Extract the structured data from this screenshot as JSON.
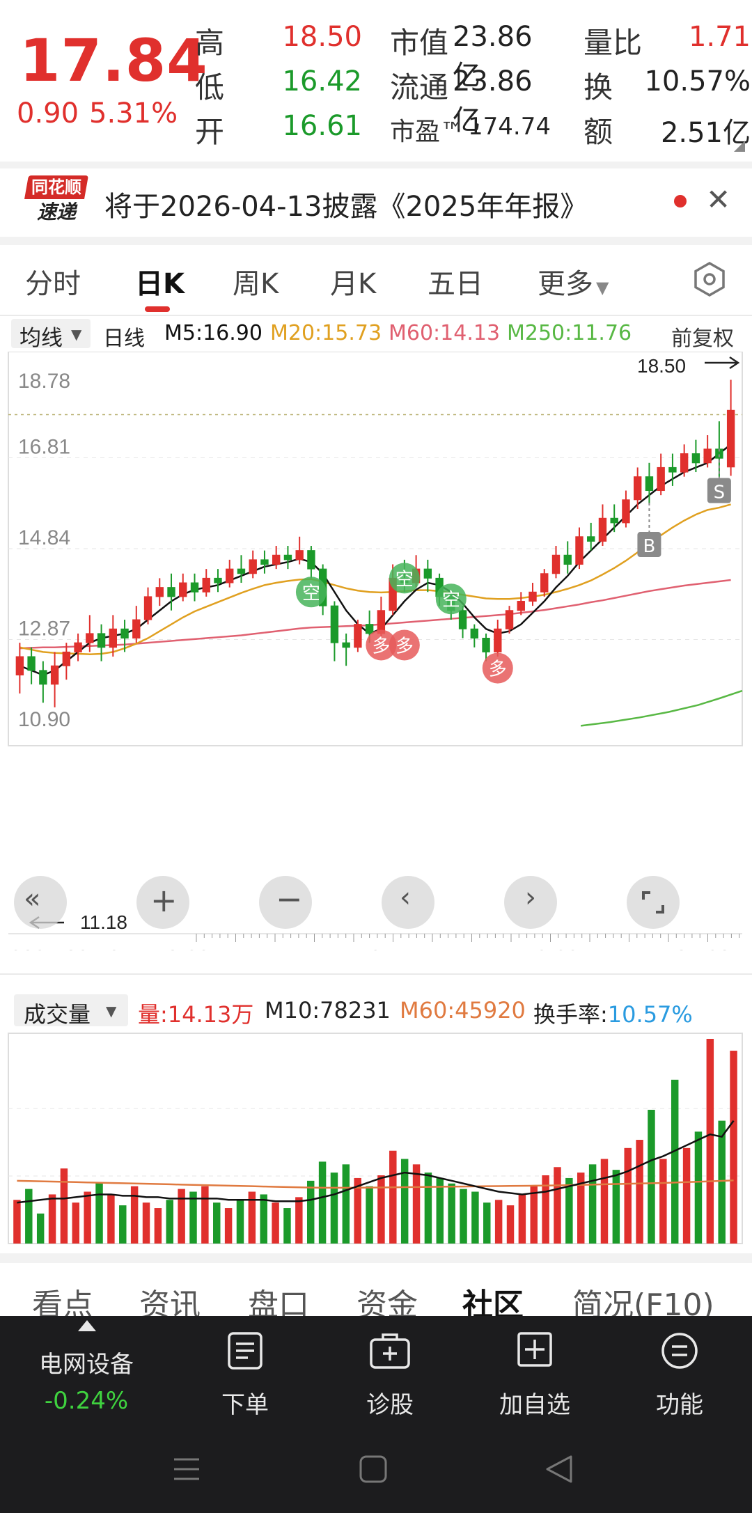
{
  "quote": {
    "price": "17.84",
    "change": "0.90",
    "change_pct": "5.31%",
    "rows": [
      {
        "l1": "高",
        "v1": "18.50",
        "c1": "red",
        "l2": "市值",
        "v2": "23.86亿",
        "l3": "量比",
        "v3": "1.71",
        "c3": "red"
      },
      {
        "l1": "低",
        "v1": "16.42",
        "c1": "green",
        "l2": "流通",
        "v2": "23.86亿",
        "l3": "换",
        "v3": "10.57%",
        "c3": "dark"
      },
      {
        "l1": "开",
        "v1": "16.61",
        "c1": "green",
        "l2": "市盈™",
        "v2": "174.74",
        "l3": "额",
        "v3": "2.51亿",
        "c3": "dark"
      }
    ]
  },
  "notice": {
    "logo_top": "同花顺",
    "logo_bottom": "速递",
    "text": "将于2026-04-13披露《2025年年报》"
  },
  "tabs": [
    {
      "label": "分时",
      "active": false
    },
    {
      "label": "日K",
      "active": true
    },
    {
      "label": "周K",
      "active": false
    },
    {
      "label": "月K",
      "active": false
    },
    {
      "label": "五日",
      "active": false
    },
    {
      "label": "更多",
      "active": false
    }
  ],
  "ma_bar": {
    "selector": "均线",
    "period": "日线",
    "m5": "M5:16.90",
    "m20": "M20:15.73",
    "m60": "M60:14.13",
    "m250": "M250:11.76",
    "adjust": "前复权"
  },
  "colors": {
    "up": "#e0302d",
    "down": "#1b9a2a",
    "m5": "#111111",
    "m20": "#e0a020",
    "m60": "#e06070",
    "m250": "#58b844",
    "turnover": "#2a9be0"
  },
  "chart_data": {
    "type": "candlestick",
    "y_ticks": [
      "18.78",
      "16.81",
      "14.84",
      "12.87",
      "10.90"
    ],
    "ylim": [
      10.9,
      18.78
    ],
    "x_ticks": [
      "2025-09-19",
      "10-28",
      "11-27",
      "12-29",
      "01-30"
    ],
    "high_marker": "18.50",
    "low_marker": "11.18",
    "signals": [
      {
        "label": "空",
        "index": 25,
        "value": 13.9,
        "kind": "sell"
      },
      {
        "label": "空",
        "index": 33,
        "value": 14.2,
        "kind": "sell"
      },
      {
        "label": "空",
        "index": 37,
        "value": 13.75,
        "kind": "sell"
      },
      {
        "label": "多",
        "index": 31,
        "value": 12.75,
        "kind": "buy"
      },
      {
        "label": "多",
        "index": 33,
        "value": 12.75,
        "kind": "buy"
      },
      {
        "label": "多",
        "index": 41,
        "value": 12.25,
        "kind": "buy"
      }
    ],
    "trade_marks": [
      {
        "label": "B",
        "index": 54,
        "value": 14.93
      },
      {
        "label": "S",
        "index": 60,
        "value": 16.1
      }
    ],
    "candles": [
      [
        12.1,
        12.5,
        12.8,
        11.7
      ],
      [
        12.5,
        12.2,
        12.7,
        11.9
      ],
      [
        12.2,
        11.9,
        12.4,
        11.5
      ],
      [
        11.9,
        12.3,
        12.6,
        11.4
      ],
      [
        12.3,
        12.6,
        12.8,
        12.0
      ],
      [
        12.6,
        12.8,
        13.0,
        12.4
      ],
      [
        12.8,
        13.0,
        13.4,
        12.6
      ],
      [
        13.0,
        12.7,
        13.2,
        12.4
      ],
      [
        12.7,
        13.1,
        13.4,
        12.5
      ],
      [
        13.1,
        12.9,
        13.3,
        12.6
      ],
      [
        12.9,
        13.3,
        13.6,
        12.8
      ],
      [
        13.3,
        13.8,
        14.0,
        13.2
      ],
      [
        13.8,
        14.0,
        14.2,
        13.6
      ],
      [
        14.0,
        13.8,
        14.3,
        13.5
      ],
      [
        13.8,
        14.1,
        14.3,
        13.7
      ],
      [
        14.1,
        13.9,
        14.3,
        13.7
      ],
      [
        13.9,
        14.2,
        14.4,
        13.8
      ],
      [
        14.2,
        14.1,
        14.4,
        13.9
      ],
      [
        14.1,
        14.4,
        14.6,
        14.0
      ],
      [
        14.4,
        14.3,
        14.7,
        14.1
      ],
      [
        14.3,
        14.6,
        14.8,
        14.2
      ],
      [
        14.6,
        14.5,
        14.8,
        14.3
      ],
      [
        14.5,
        14.7,
        14.9,
        14.4
      ],
      [
        14.7,
        14.6,
        14.9,
        14.4
      ],
      [
        14.6,
        14.8,
        15.1,
        14.5
      ],
      [
        14.8,
        14.4,
        14.9,
        14.2
      ],
      [
        14.4,
        13.6,
        14.5,
        13.4
      ],
      [
        13.6,
        12.8,
        13.7,
        12.4
      ],
      [
        12.8,
        12.7,
        13.0,
        12.3
      ],
      [
        12.7,
        13.2,
        13.3,
        12.6
      ],
      [
        13.2,
        13.0,
        13.5,
        12.8
      ],
      [
        13.0,
        13.5,
        13.8,
        12.9
      ],
      [
        13.5,
        14.2,
        14.5,
        13.4
      ],
      [
        14.2,
        14.1,
        14.6,
        13.9
      ],
      [
        14.1,
        14.4,
        14.7,
        14.0
      ],
      [
        14.4,
        14.2,
        14.6,
        13.9
      ],
      [
        14.2,
        13.8,
        14.3,
        13.6
      ],
      [
        13.8,
        13.5,
        13.9,
        13.3
      ],
      [
        13.5,
        13.1,
        13.6,
        12.9
      ],
      [
        13.1,
        12.9,
        13.2,
        12.7
      ],
      [
        12.9,
        12.6,
        13.0,
        12.4
      ],
      [
        12.6,
        13.1,
        13.3,
        12.5
      ],
      [
        13.1,
        13.5,
        13.6,
        13.0
      ],
      [
        13.5,
        13.7,
        13.9,
        13.4
      ],
      [
        13.7,
        13.9,
        14.1,
        13.6
      ],
      [
        13.9,
        14.3,
        14.4,
        13.8
      ],
      [
        14.3,
        14.7,
        14.9,
        14.2
      ],
      [
        14.7,
        14.5,
        15.0,
        14.3
      ],
      [
        14.5,
        15.1,
        15.3,
        14.4
      ],
      [
        15.1,
        15.0,
        15.4,
        14.8
      ],
      [
        15.0,
        15.5,
        15.8,
        14.9
      ],
      [
        15.5,
        15.4,
        15.8,
        15.2
      ],
      [
        15.4,
        15.9,
        16.1,
        15.3
      ],
      [
        15.9,
        16.4,
        16.6,
        15.7
      ],
      [
        16.4,
        16.1,
        16.7,
        15.8
      ],
      [
        16.1,
        16.6,
        16.9,
        16.0
      ],
      [
        16.6,
        16.5,
        16.9,
        16.2
      ],
      [
        16.5,
        16.9,
        17.1,
        16.4
      ],
      [
        16.9,
        16.7,
        17.2,
        16.5
      ],
      [
        16.7,
        17.0,
        17.3,
        16.6
      ],
      [
        17.0,
        16.8,
        17.6,
        16.4
      ],
      [
        16.61,
        17.84,
        18.5,
        16.42
      ]
    ],
    "ma5": [
      12.3,
      12.2,
      12.1,
      12.2,
      12.4,
      12.6,
      12.8,
      12.9,
      12.95,
      13.0,
      13.1,
      13.3,
      13.5,
      13.7,
      13.85,
      13.95,
      14.0,
      14.05,
      14.15,
      14.25,
      14.35,
      14.45,
      14.5,
      14.55,
      14.62,
      14.55,
      14.3,
      13.9,
      13.5,
      13.2,
      13.0,
      13.1,
      13.4,
      13.7,
      13.95,
      14.1,
      14.05,
      13.9,
      13.65,
      13.35,
      13.1,
      13.0,
      13.05,
      13.2,
      13.45,
      13.7,
      14.0,
      14.25,
      14.55,
      14.8,
      15.05,
      15.3,
      15.55,
      15.8,
      16.0,
      16.2,
      16.35,
      16.5,
      16.6,
      16.7,
      16.9,
      17.1
    ],
    "ma20": [
      12.7,
      12.65,
      12.6,
      12.58,
      12.57,
      12.56,
      12.55,
      12.56,
      12.6,
      12.68,
      12.78,
      12.9,
      13.05,
      13.2,
      13.35,
      13.48,
      13.58,
      13.68,
      13.78,
      13.88,
      13.97,
      14.05,
      14.1,
      14.14,
      14.17,
      14.18,
      14.12,
      14.05,
      13.98,
      13.93,
      13.9,
      13.89,
      13.9,
      13.92,
      13.94,
      13.94,
      13.92,
      13.88,
      13.84,
      13.8,
      13.76,
      13.75,
      13.75,
      13.77,
      13.8,
      13.84,
      13.9,
      13.97,
      14.05,
      14.15,
      14.28,
      14.42,
      14.58,
      14.76,
      14.95,
      15.13,
      15.3,
      15.45,
      15.58,
      15.68,
      15.73,
      15.8
    ],
    "ma60": [
      12.68,
      12.69,
      12.7,
      12.7,
      12.71,
      12.72,
      12.73,
      12.74,
      12.75,
      12.76,
      12.78,
      12.8,
      12.82,
      12.84,
      12.86,
      12.88,
      12.9,
      12.92,
      12.94,
      12.96,
      12.99,
      13.02,
      13.05,
      13.08,
      13.11,
      13.13,
      13.14,
      13.15,
      13.16,
      13.17,
      13.18,
      13.2,
      13.22,
      13.24,
      13.26,
      13.28,
      13.3,
      13.32,
      13.34,
      13.36,
      13.38,
      13.4,
      13.42,
      13.45,
      13.48,
      13.51,
      13.55,
      13.59,
      13.63,
      13.68,
      13.72,
      13.77,
      13.82,
      13.87,
      13.92,
      13.96,
      14.0,
      14.04,
      14.07,
      14.1,
      14.13,
      14.16
    ],
    "ma250_points": [
      [
        0.78,
        11.0
      ],
      [
        0.82,
        11.08
      ],
      [
        0.86,
        11.18
      ],
      [
        0.9,
        11.3
      ],
      [
        0.94,
        11.45
      ],
      [
        0.97,
        11.6
      ],
      [
        1.0,
        11.76
      ]
    ],
    "volume": {
      "selector": "成交量",
      "vol": "量:14.13万",
      "m10": "M10:78231",
      "m60": "M60:45920",
      "turnover_label": "换手率:",
      "turnover_value": "10.57%",
      "ymax": 150000,
      "values": [
        32000,
        40000,
        22000,
        36000,
        55000,
        30000,
        38000,
        45000,
        36000,
        28000,
        42000,
        30000,
        26000,
        32000,
        40000,
        38000,
        42000,
        30000,
        26000,
        32000,
        38000,
        36000,
        30000,
        26000,
        34000,
        46000,
        60000,
        52000,
        58000,
        48000,
        42000,
        50000,
        68000,
        62000,
        58000,
        52000,
        48000,
        44000,
        40000,
        38000,
        30000,
        32000,
        28000,
        36000,
        42000,
        50000,
        56000,
        48000,
        52000,
        58000,
        62000,
        54000,
        70000,
        76000,
        98000,
        62000,
        120000,
        70000,
        82000,
        150000,
        90000,
        141300
      ],
      "m10_line": [
        30000,
        31000,
        32000,
        33000,
        33000,
        34000,
        35000,
        36000,
        36000,
        35000,
        35000,
        34000,
        34000,
        33000,
        33000,
        33000,
        33000,
        33000,
        32000,
        32000,
        32000,
        32000,
        31000,
        31000,
        31000,
        32000,
        34000,
        36000,
        39000,
        42000,
        45000,
        48000,
        50000,
        52000,
        51000,
        50000,
        48000,
        46000,
        44000,
        42000,
        40000,
        38000,
        37000,
        36000,
        37000,
        38000,
        40000,
        42000,
        44000,
        46000,
        48000,
        50000,
        53000,
        57000,
        61000,
        64000,
        68000,
        72000,
        76000,
        80000,
        78231,
        90000
      ],
      "m60_line": [
        46000,
        45800,
        45600,
        45400,
        45200,
        45000,
        44800,
        44600,
        44400,
        44200,
        44000,
        43800,
        43600,
        43400,
        43200,
        43000,
        42800,
        42600,
        42400,
        42200,
        42000,
        41800,
        41600,
        41400,
        41200,
        41000,
        40900,
        40900,
        40900,
        40900,
        41000,
        41100,
        41200,
        41300,
        41400,
        41500,
        41600,
        41700,
        41800,
        41900,
        42000,
        42100,
        42200,
        42300,
        42400,
        42500,
        42600,
        42800,
        43000,
        43200,
        43400,
        43600,
        43800,
        44000,
        44200,
        44400,
        44700,
        45000,
        45300,
        45600,
        45920,
        46300
      ]
    }
  },
  "bottom_tabs": [
    {
      "label": "看点",
      "active": false
    },
    {
      "label": "资讯",
      "active": false
    },
    {
      "label": "盘口",
      "active": false
    },
    {
      "label": "资金",
      "active": false
    },
    {
      "label": "社区",
      "active": true
    },
    {
      "label": "简况(F10)",
      "active": false
    }
  ],
  "bottom_bar": {
    "sector_name": "电网设备",
    "sector_change": "-0.24%",
    "actions": [
      {
        "label": "下单",
        "icon": "order-icon"
      },
      {
        "label": "诊股",
        "icon": "diagnose-icon"
      },
      {
        "label": "加自选",
        "icon": "add-watchlist-icon"
      },
      {
        "label": "功能",
        "icon": "menu-icon"
      }
    ]
  }
}
